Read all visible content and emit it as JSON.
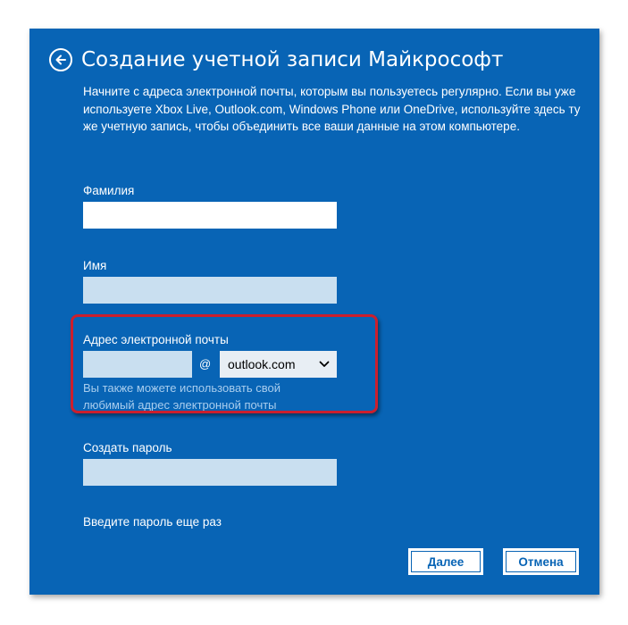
{
  "dialog": {
    "title": "Создание учетной записи Майкрософт",
    "description": "Начните с адреса электронной почты, которым вы пользуетесь регулярно. Если вы уже используете Xbox Live, Outlook.com, Windows Phone или OneDrive, используйте здесь ту же учетную запись, чтобы объединить все ваши данные на этом компьютере."
  },
  "form": {
    "last_name_label": "Фамилия",
    "last_name_value": "",
    "first_name_label": "Имя",
    "first_name_value": "",
    "email_label": "Адрес электронной почты",
    "email_user_value": "",
    "at_sign": "@",
    "email_domain_selected": "outlook.com",
    "email_hint": "Вы также можете использовать свой любимый адрес электронной почты",
    "password_label": "Создать пароль",
    "password_value": "",
    "password_repeat_label": "Введите пароль еще раз"
  },
  "buttons": {
    "next_label": "Далее",
    "cancel_label": "Отмена"
  },
  "icons": {
    "back": "back-arrow-icon",
    "dropdown": "chevron-down-icon"
  },
  "colors": {
    "panel_background": "#0864b5",
    "active_field": "#ffffff",
    "inactive_field": "#c9dff0",
    "hint_link": "#a8cdee",
    "highlight_border": "#cc1f2d"
  }
}
